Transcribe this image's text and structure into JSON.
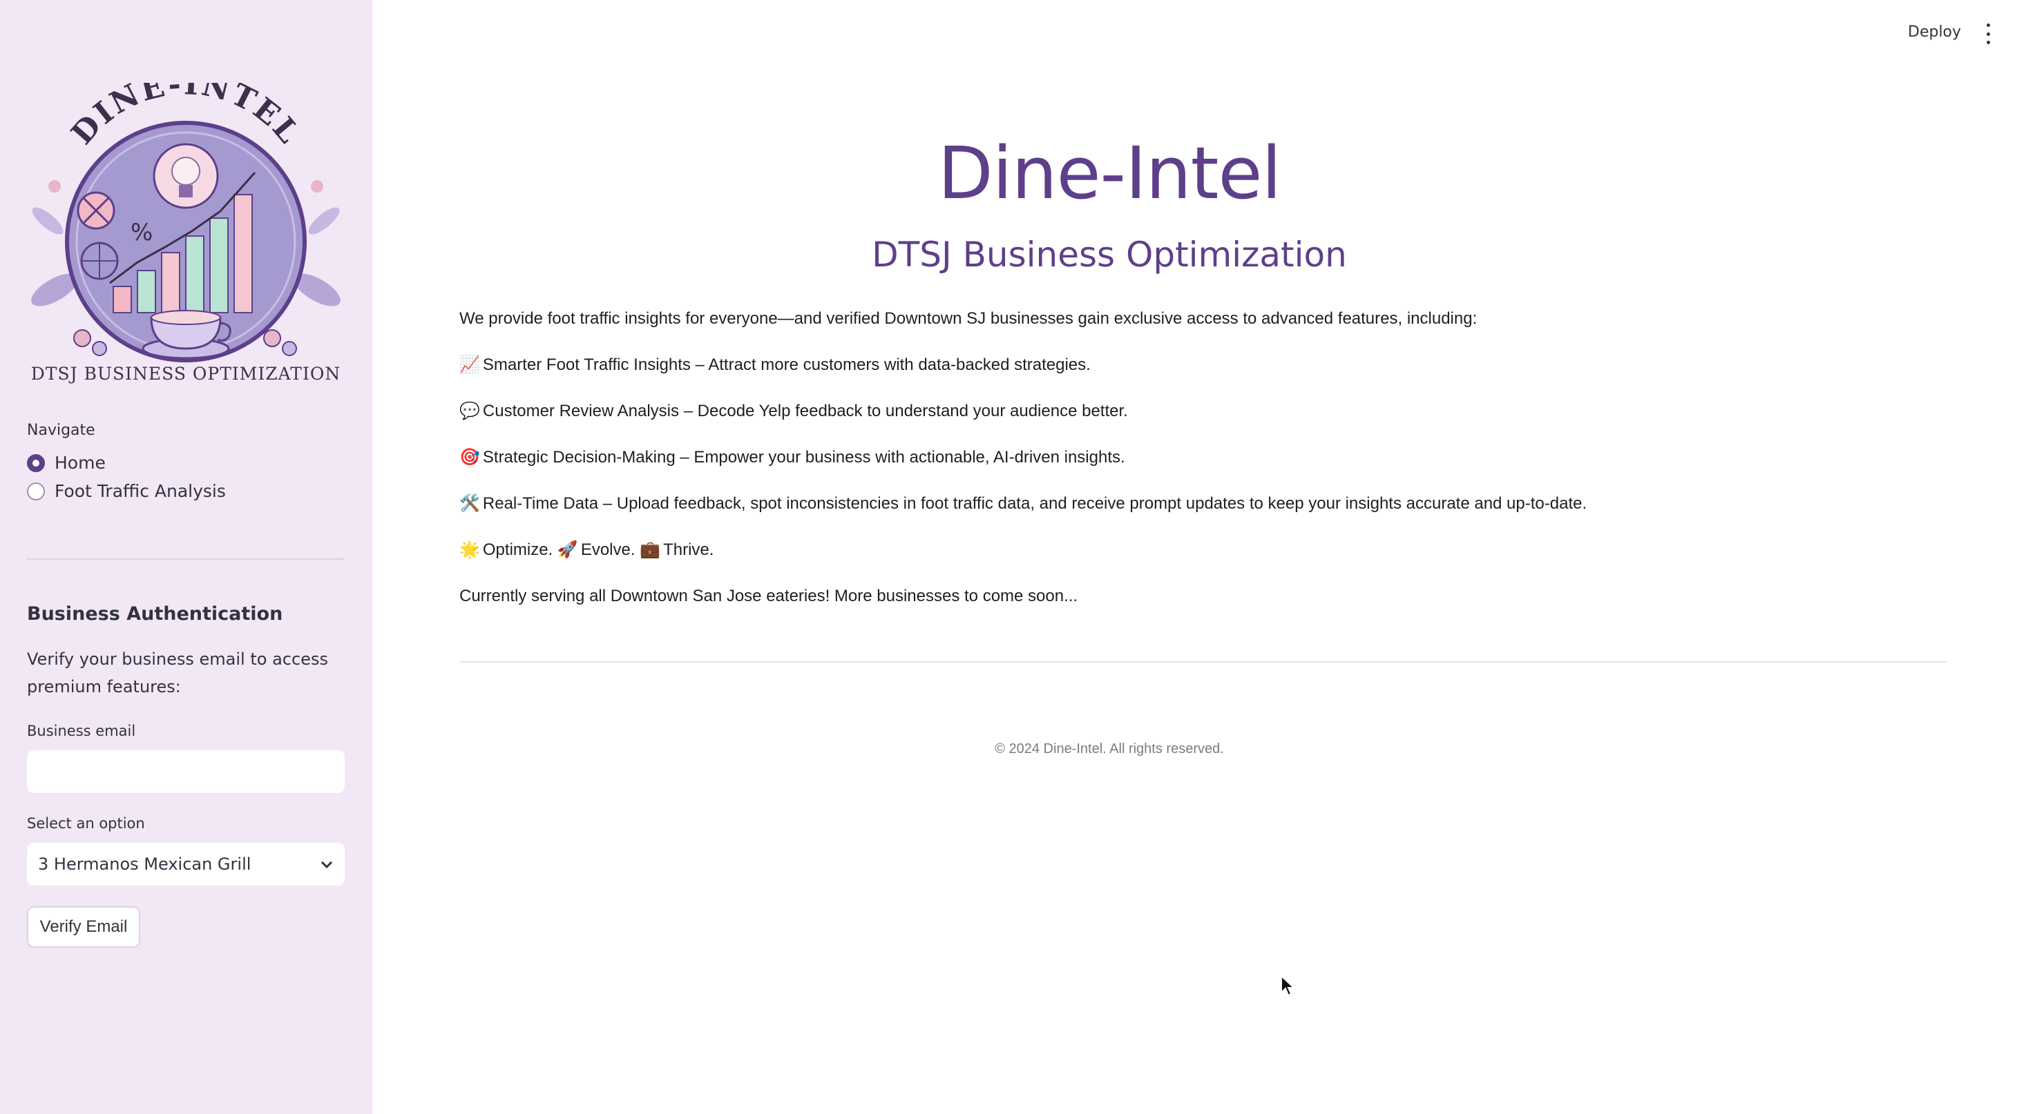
{
  "sidebar": {
    "logo": {
      "arc_text": "DINE-INTEL",
      "banner_text": "DTSJ BUSINESS OPTIMIZATION",
      "colors": {
        "circle": "#a59ad0",
        "ring": "#5e3f8a",
        "bar1": "#f2b8c6",
        "bar2": "#b9e4d4",
        "bar3": "#f4c6cf",
        "text": "#3e2f4d"
      }
    },
    "navigate_label": "Navigate",
    "nav_options": [
      {
        "label": "Home",
        "selected": true
      },
      {
        "label": "Foot Traffic Analysis",
        "selected": false
      }
    ],
    "auth": {
      "title": "Business Authentication",
      "description": "Verify your business email to access premium features:",
      "email_label": "Business email",
      "email_value": "",
      "select_label": "Select an option",
      "select_value": "3 Hermanos Mexican Grill",
      "verify_button": "Verify Email"
    }
  },
  "header": {
    "deploy_label": "Deploy",
    "menu_icon": "kebab-menu-icon"
  },
  "main": {
    "title": "Dine-Intel",
    "subtitle": "DTSJ Business Optimization",
    "intro": "We provide foot traffic insights for everyone—and verified Downtown SJ businesses gain exclusive access to advanced features, including:",
    "features": [
      {
        "emoji": "📈",
        "text": "Smarter Foot Traffic Insights – Attract more customers with data-backed strategies."
      },
      {
        "emoji": "💬",
        "text": "Customer Review Analysis – Decode Yelp feedback to understand your audience better."
      },
      {
        "emoji": "🎯",
        "text": "Strategic Decision-Making – Empower your business with actionable, AI-driven insights."
      },
      {
        "emoji": "🛠️",
        "text": "Real-Time Data – Upload feedback, spot inconsistencies in foot traffic data, and receive prompt updates to keep your insights accurate and up-to-date."
      }
    ],
    "tagline": {
      "emoji1": "🌟",
      "word1": "Optimize.",
      "emoji2": "🚀",
      "word2": "Evolve.",
      "emoji3": "💼",
      "word3": "Thrive."
    },
    "closing": "Currently serving all Downtown San Jose eateries! More businesses to come soon...",
    "footer": "© 2024 Dine-Intel. All rights reserved."
  },
  "colors": {
    "sidebar_bg": "#f2e7f5",
    "accent": "#5e3f8a"
  }
}
